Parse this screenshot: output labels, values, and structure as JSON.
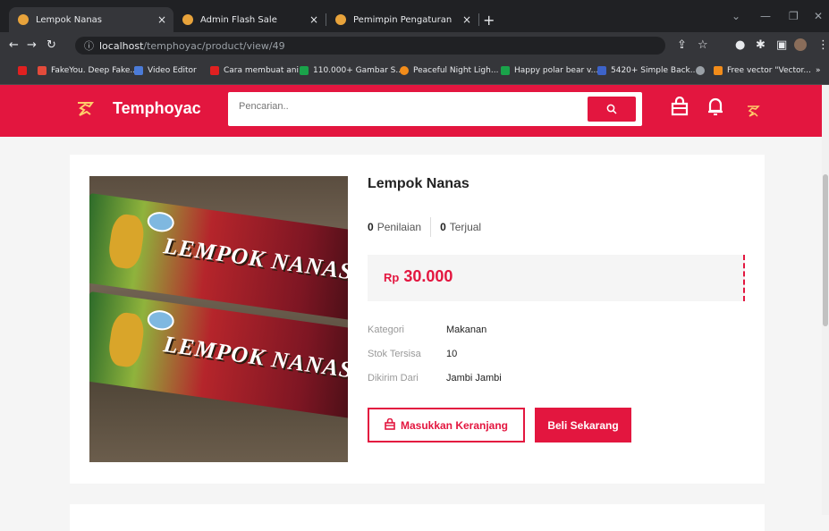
{
  "browser": {
    "tabs": [
      {
        "title": "Lempok Nanas",
        "active": true,
        "fav_color": "#e8a33b"
      },
      {
        "title": "Admin Flash Sale",
        "active": false,
        "fav_color": "#e8a33b"
      },
      {
        "title": "Pemimpin Pengaturan",
        "active": false,
        "fav_color": "#e8a33b"
      }
    ],
    "close_glyph": "×",
    "new_tab_glyph": "+",
    "url_host": "localhost",
    "url_path": "/temphoyac/product/view/49",
    "bookmarks": [
      {
        "label": "FakeYou. Deep Fake...",
        "color": "#e34b3b"
      },
      {
        "label": "Video Editor",
        "color": "#4b7bd8"
      },
      {
        "label": "Cara membuat ani...",
        "color": "#e02020"
      },
      {
        "label": "110.000+ Gambar S...",
        "color": "#1aa34a"
      },
      {
        "label": "Peaceful Night Ligh...",
        "color": "#f28c1a"
      },
      {
        "label": "Happy polar bear v...",
        "color": "#1aa34a"
      },
      {
        "label": "5420+ Simple Back...",
        "color": "#3d63c9"
      },
      {
        "label": "Free vector \"Vector...",
        "color": "#f28c1a"
      }
    ]
  },
  "header": {
    "brand": "Temphoyac",
    "search_placeholder": "Pencarian..",
    "accent": "#e3163f"
  },
  "product": {
    "name": "Lempok Nanas",
    "image_text": "LEMPOK NANAS",
    "ratings_count": "0",
    "ratings_label": "Penilaian",
    "sold_count": "0",
    "sold_label": "Terjual",
    "currency": "Rp",
    "price": "30.000",
    "details": [
      {
        "key": "Kategori",
        "value": "Makanan"
      },
      {
        "key": "Stok Tersisa",
        "value": "10"
      },
      {
        "key": "Dikirim Dari",
        "value": "Jambi Jambi"
      }
    ],
    "add_to_cart_label": "Masukkan Keranjang",
    "buy_now_label": "Beli Sekarang"
  }
}
